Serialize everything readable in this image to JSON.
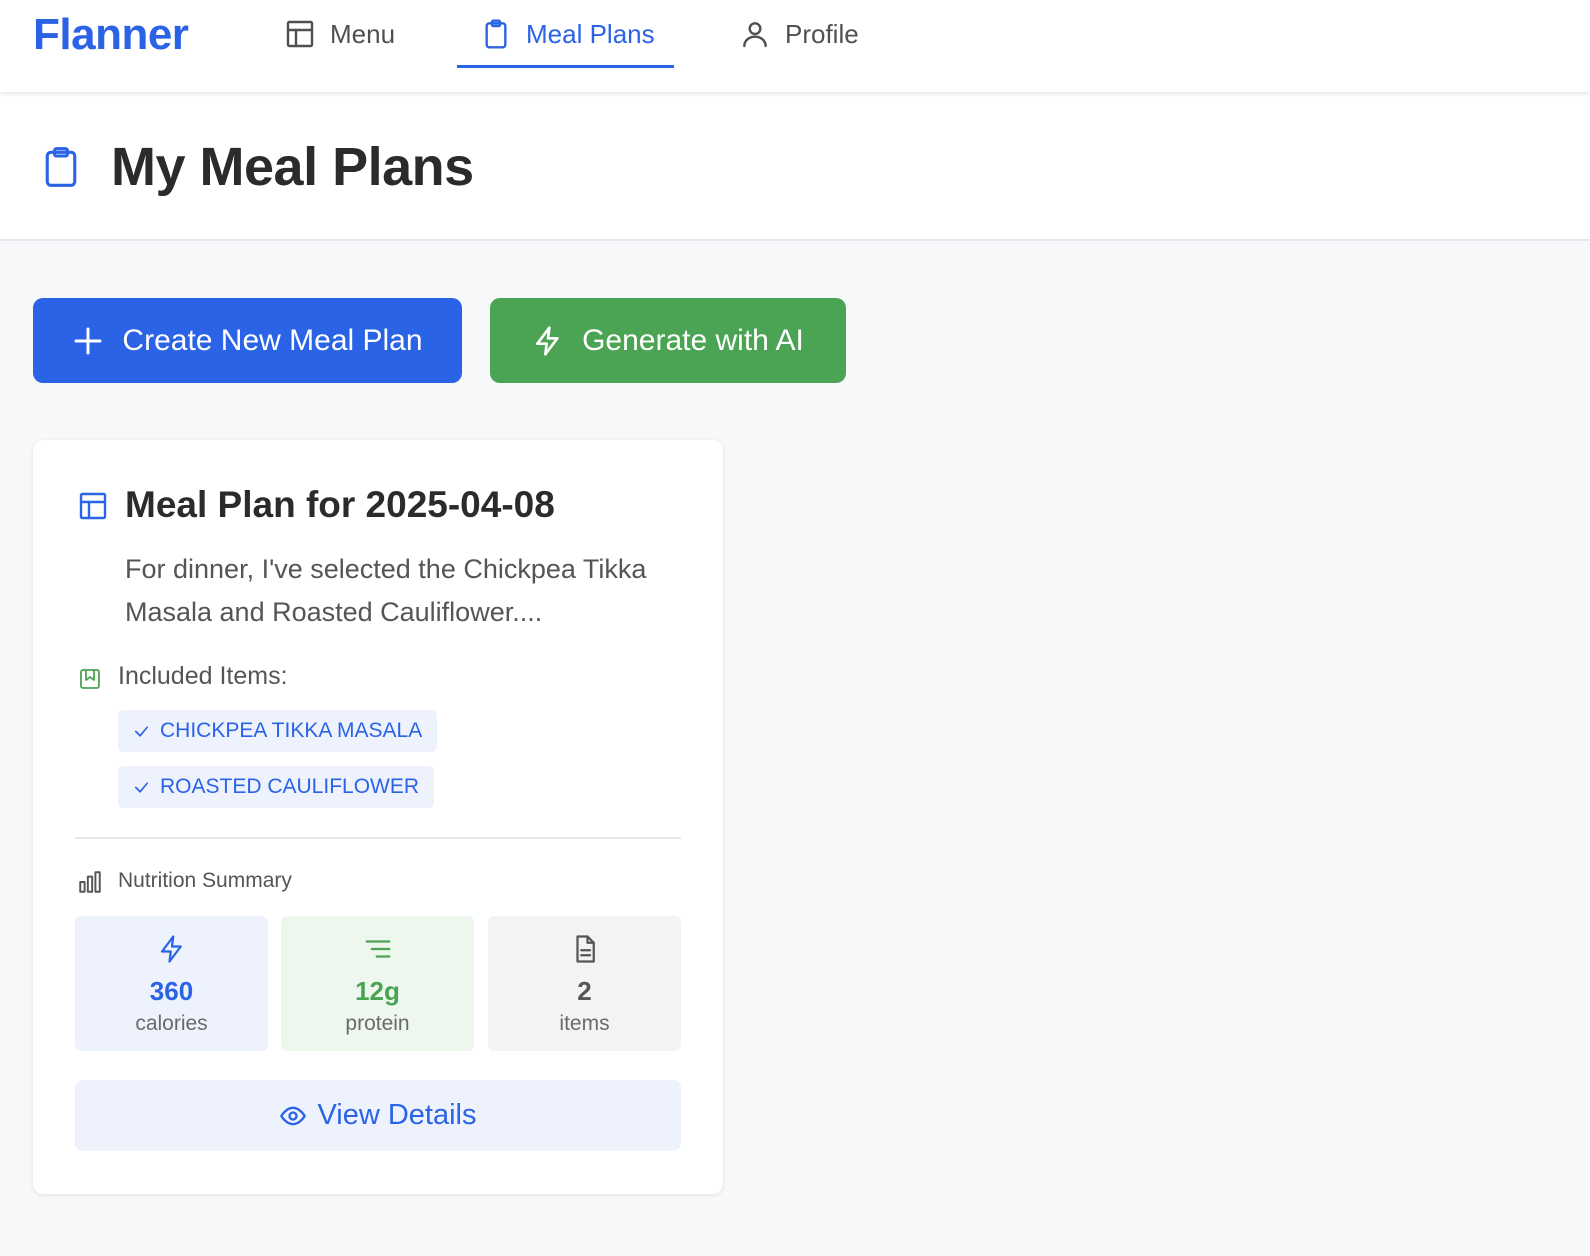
{
  "app": {
    "brand": "Flanner"
  },
  "nav": {
    "items": [
      {
        "label": "Menu",
        "icon": "layout-icon",
        "active": false
      },
      {
        "label": "Meal Plans",
        "icon": "clipboard-icon",
        "active": true
      },
      {
        "label": "Profile",
        "icon": "user-icon",
        "active": false
      }
    ]
  },
  "page": {
    "title": "My Meal Plans",
    "icon": "clipboard-icon"
  },
  "actions": {
    "create_label": "Create New Meal Plan",
    "ai_label": "Generate with AI"
  },
  "meal_plan": {
    "title": "Meal Plan for 2025-04-08",
    "description": "For dinner, I've selected the Chickpea Tikka Masala and Roasted Cauliflower....",
    "included_label": "Included Items:",
    "items": [
      "Chickpea Tikka Masala",
      "Roasted Cauliflower"
    ],
    "nutrition_label": "Nutrition Summary",
    "stats": {
      "calories": {
        "value": "360",
        "unit": "calories"
      },
      "protein": {
        "value": "12g",
        "unit": "protein"
      },
      "items": {
        "value": "2",
        "unit": "items"
      }
    },
    "view_label": "View Details"
  },
  "colors": {
    "primary": "#2b63e6",
    "success": "#4aa453",
    "background": "#f7f8fa"
  }
}
